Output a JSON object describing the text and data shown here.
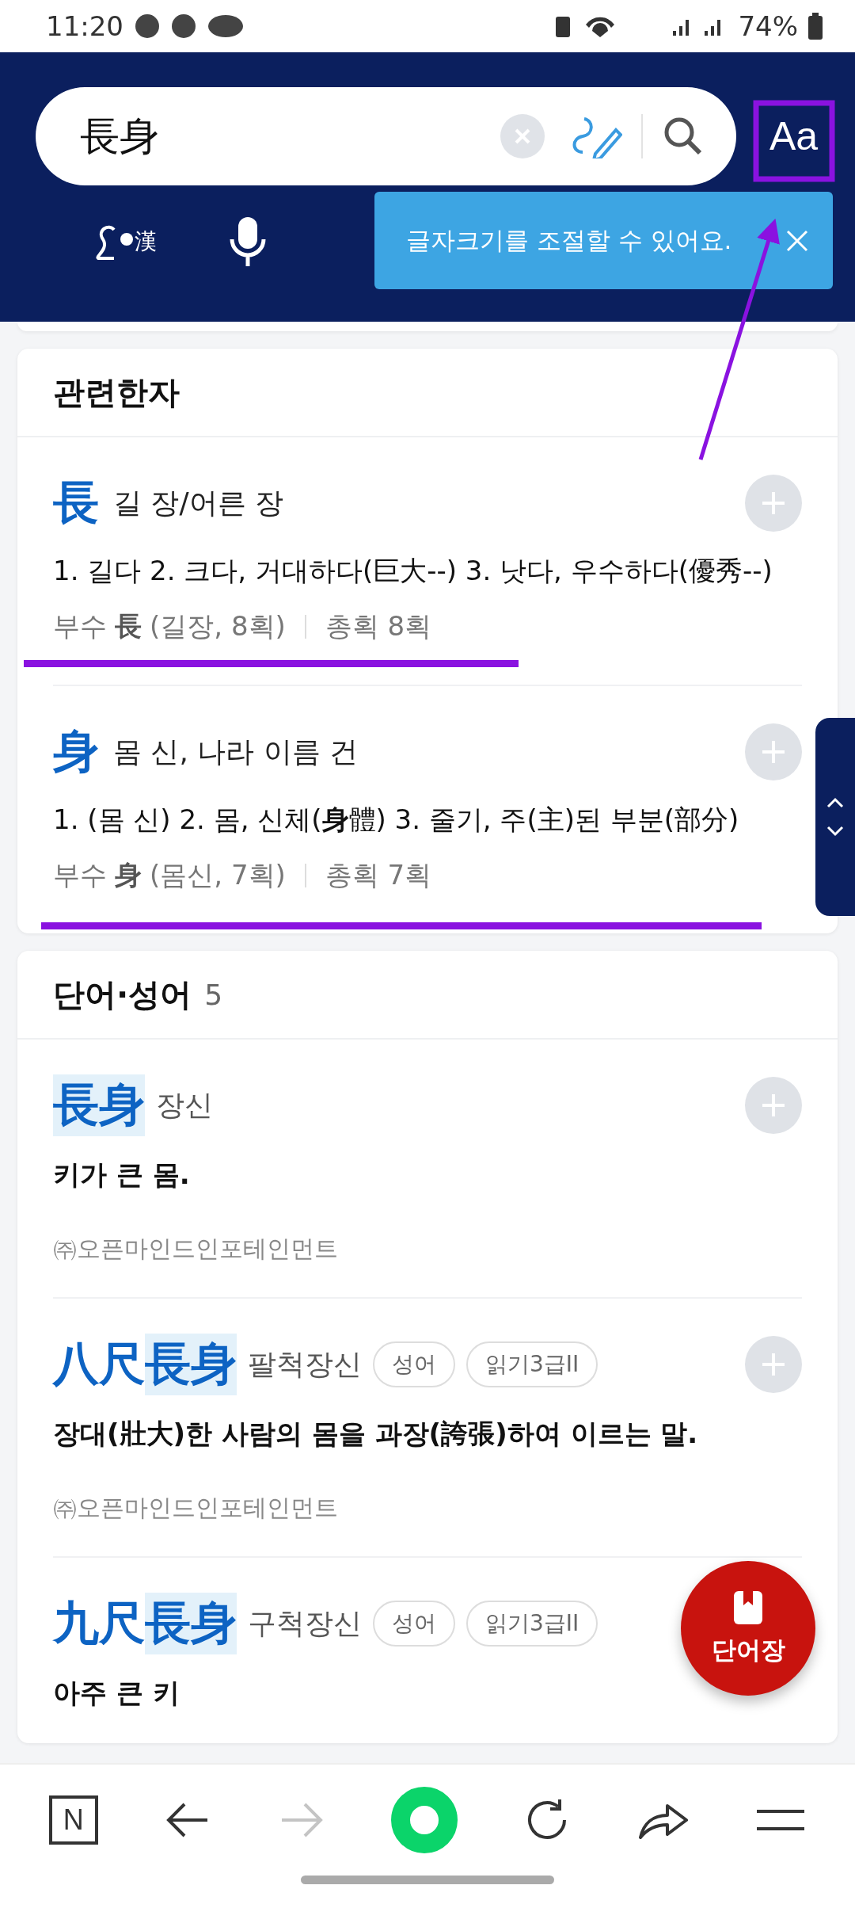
{
  "status_bar": {
    "time": "11:20",
    "battery": "74%"
  },
  "search": {
    "value": "長身",
    "font_size_button": "Aa",
    "hanja_input_label": "漢"
  },
  "tooltip": {
    "text": "글자크기를 조절할 수 있어요."
  },
  "related_hanja": {
    "title": "관련한자",
    "items": [
      {
        "hanja": "長",
        "reading": "길 장/어른 장",
        "meaning": "1. 길다 2. 크다, 거대하다(巨大--) 3. 낫다, 우수하다(優秀--)",
        "radical_label": "부수",
        "radical": "長",
        "radical_info": "(길장, 8획)",
        "strokes": "총획 8획"
      },
      {
        "hanja": "身",
        "reading": "몸 신, 나라 이름 건",
        "meaning": "1. (몸 신) 2. 몸, 신체(**身**體) 3. 줄기, 주(主)된 부분(部分)",
        "radical_label": "부수",
        "radical": "身",
        "radical_info": "(몸신, 7획)",
        "strokes": "총획 7획"
      }
    ]
  },
  "words": {
    "title": "단어·성어",
    "count": "5",
    "items": [
      {
        "parts": [
          {
            "text": "長身",
            "highlighted": true
          }
        ],
        "reading": "장신",
        "meaning": "키가 큰 몸.",
        "source": "㈜오픈마인드인포테인먼트"
      },
      {
        "parts": [
          {
            "text": "八尺",
            "highlighted": false
          },
          {
            "text": "長身",
            "highlighted": true
          }
        ],
        "reading": "팔척장신",
        "tags": [
          "성어",
          "읽기3급II"
        ],
        "meaning": "장대(壯大)한 사람의 몸을 과장(誇張)하여 이르는 말.",
        "source": "㈜오픈마인드인포테인먼트"
      },
      {
        "parts": [
          {
            "text": "九尺",
            "highlighted": false
          },
          {
            "text": "長身",
            "highlighted": true
          }
        ],
        "reading": "구척장신",
        "tags": [
          "성어",
          "읽기3급II"
        ],
        "meaning": "아주 큰 키"
      }
    ]
  },
  "fab": {
    "label": "단어장"
  },
  "bottom_nav": {
    "logo": "N",
    "forward_disabled": true
  },
  "annotations": [
    {
      "kind": "box"
    },
    {
      "kind": "arrow"
    },
    {
      "kind": "underline"
    },
    {
      "kind": "underline"
    }
  ]
}
